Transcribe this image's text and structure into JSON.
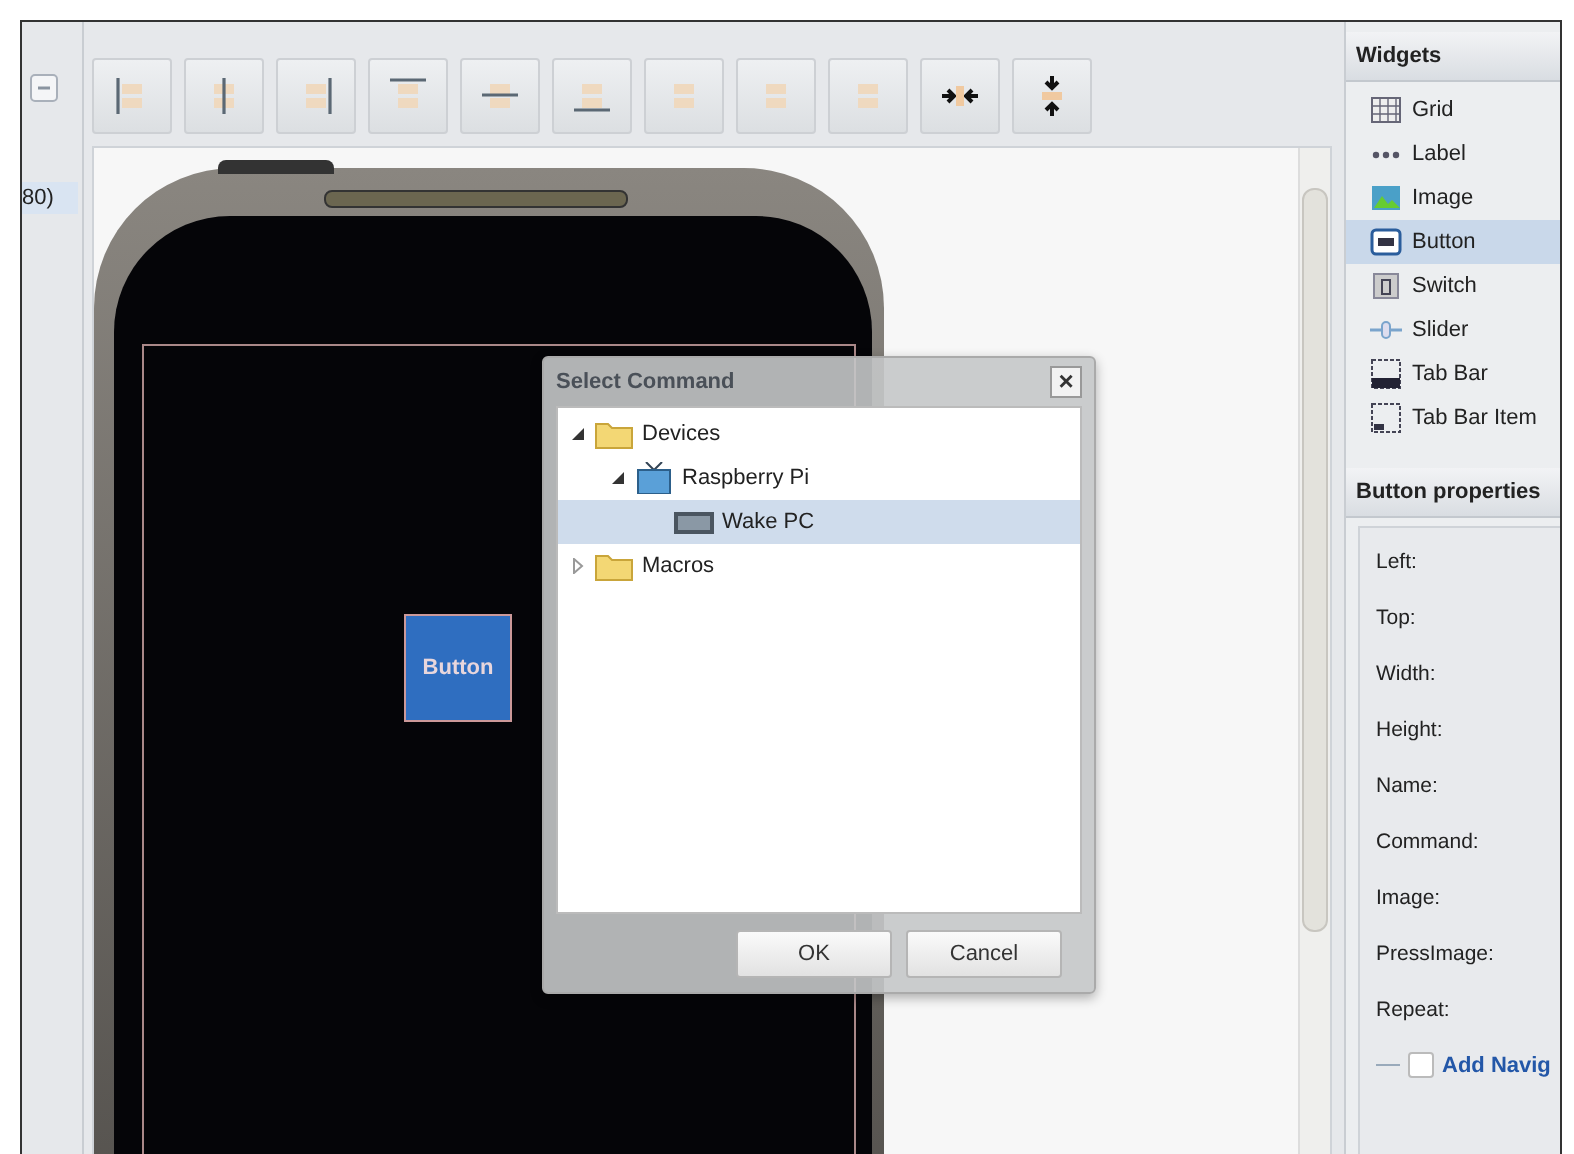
{
  "left_panel": {
    "row_text": "80)"
  },
  "canvas": {
    "phone_button": {
      "label": "Button"
    }
  },
  "widgets": {
    "title": "Widgets",
    "items": [
      {
        "label": "Grid",
        "kind": "grid",
        "selected": false
      },
      {
        "label": "Label",
        "kind": "label",
        "selected": false
      },
      {
        "label": "Image",
        "kind": "image",
        "selected": false
      },
      {
        "label": "Button",
        "kind": "button",
        "selected": true
      },
      {
        "label": "Switch",
        "kind": "switch",
        "selected": false
      },
      {
        "label": "Slider",
        "kind": "slider",
        "selected": false
      },
      {
        "label": "Tab Bar",
        "kind": "tabbar",
        "selected": false
      },
      {
        "label": "Tab Bar Item",
        "kind": "tabbaritem",
        "selected": false
      }
    ]
  },
  "properties": {
    "title": "Button properties",
    "fields": [
      "Left:",
      "Top:",
      "Width:",
      "Height:",
      "Name:",
      "Command:",
      "Image:",
      "PressImage:",
      "Repeat:"
    ],
    "navigation": {
      "label": "Add Navig",
      "checked": false
    }
  },
  "dialog": {
    "title": "Select Command",
    "close": "×",
    "tree": [
      {
        "label": "Devices",
        "kind": "folder",
        "expanded": true,
        "selected": false,
        "children": [
          {
            "label": "Raspberry Pi",
            "kind": "device",
            "expanded": true,
            "selected": false,
            "children": [
              {
                "label": "Wake PC",
                "kind": "command",
                "selected": true
              }
            ]
          }
        ]
      },
      {
        "label": "Macros",
        "kind": "folder",
        "expanded": false,
        "selected": false
      }
    ],
    "buttons": [
      "OK",
      "Cancel"
    ]
  }
}
